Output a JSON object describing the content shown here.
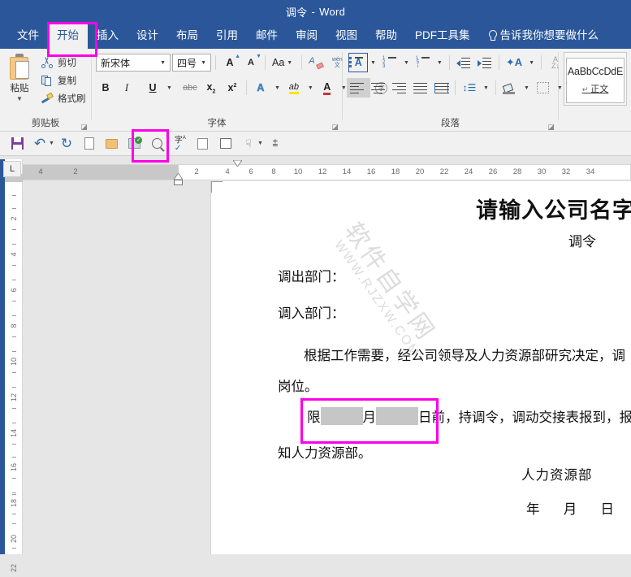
{
  "titlebar": {
    "document_name": "调令",
    "separator": "-",
    "app_name": "Word"
  },
  "tabs": [
    {
      "id": "file",
      "label": "文件"
    },
    {
      "id": "home",
      "label": "开始",
      "active": true,
      "highlighted": true
    },
    {
      "id": "insert",
      "label": "插入"
    },
    {
      "id": "design",
      "label": "设计"
    },
    {
      "id": "layout",
      "label": "布局"
    },
    {
      "id": "references",
      "label": "引用"
    },
    {
      "id": "mailings",
      "label": "邮件"
    },
    {
      "id": "review",
      "label": "审阅"
    },
    {
      "id": "view",
      "label": "视图"
    },
    {
      "id": "help",
      "label": "帮助"
    },
    {
      "id": "pdftools",
      "label": "PDF工具集"
    },
    {
      "id": "tellme",
      "label": "告诉我你想要做什么"
    }
  ],
  "ribbon": {
    "clipboard": {
      "group_label": "剪贴板",
      "paste_label": "粘贴",
      "cut_label": "剪切",
      "copy_label": "复制",
      "format_painter_label": "格式刷"
    },
    "font": {
      "group_label": "字体",
      "font_name": "新宋体",
      "font_size": "四号",
      "bold": "B",
      "italic": "I",
      "underline": "U",
      "strikethrough": "abc",
      "subscript": "x",
      "superscript": "x",
      "text_effects": "A",
      "highlight": "ab",
      "font_color": "A",
      "char_shading": "A",
      "char_border": "字",
      "grow_font": "A",
      "shrink_font": "A",
      "change_case": "Aa",
      "clear_formatting": "A",
      "phonetic_guide": "wén文",
      "underline_highlighted": true
    },
    "paragraph": {
      "group_label": "段落",
      "bullets": "bullets-icon",
      "numbering": "numbering-icon",
      "multilevel": "multilevel-list-icon",
      "decrease_indent": "decrease-indent-icon",
      "increase_indent": "increase-indent-icon",
      "asian_layout": "asian-layout-icon",
      "sort": "AZ",
      "show_marks": "pilcrow-icon",
      "align_left": "align-left-icon",
      "align_center": "align-center-icon",
      "align_right": "align-right-icon",
      "justify": "justify-icon",
      "distribute": "distribute-icon",
      "line_spacing": "line-spacing-icon",
      "shading": "shading-icon",
      "borders": "borders-icon"
    },
    "styles": {
      "sample_text": "AaBbCcDdE",
      "style_name": "正文",
      "pilcrow": "↵"
    }
  },
  "quick_access": [
    {
      "id": "save",
      "icon": "save-icon"
    },
    {
      "id": "undo",
      "icon": "undo-icon"
    },
    {
      "id": "redo",
      "icon": "redo-icon"
    },
    {
      "id": "new",
      "icon": "new-document-icon"
    },
    {
      "id": "open",
      "icon": "open-folder-icon"
    },
    {
      "id": "quickprint",
      "icon": "quick-print-icon"
    },
    {
      "id": "preview",
      "icon": "print-preview-icon"
    },
    {
      "id": "spelling",
      "icon": "spelling-check-icon"
    },
    {
      "id": "attach",
      "icon": "attachment-icon"
    },
    {
      "id": "edit",
      "icon": "edit-table-icon"
    },
    {
      "id": "touch",
      "icon": "touch-mode-icon"
    },
    {
      "id": "more",
      "icon": "more-options-icon"
    }
  ],
  "rulers": {
    "tab_stop_marker": "L",
    "horizontal_left_margin": [
      "4",
      "2"
    ],
    "horizontal_ticks": [
      "2",
      "4",
      "6",
      "8",
      "10",
      "12",
      "14",
      "16",
      "18",
      "20",
      "22",
      "24",
      "26",
      "28",
      "30",
      "32",
      "34"
    ],
    "vertical_ticks": [
      "2",
      "4",
      "6",
      "8",
      "10",
      "12",
      "14",
      "16",
      "18",
      "20",
      "22"
    ]
  },
  "document": {
    "watermark_line1": "软件自学网",
    "watermark_line2": "WWW.RJZXW.COM",
    "title": "请输入公司名字",
    "subtitle": "调令",
    "line_from_dept": "调出部门：",
    "line_to_dept": "调入部门：",
    "body_paragraph": "根据工作需要，经公司领导及人力资源部研究决定，调",
    "body_paragraph_cont": "岗位。",
    "limit_prefix": "限",
    "limit_month": "月",
    "limit_day": "日前，",
    "limit_rest": "持调令，调动交接表报到，报",
    "limit_next_line": "知人力资源部。",
    "signature_dept": "人力资源部",
    "signature_date": "年 月 日"
  },
  "annotations": {
    "highlight_color": "#ff00e6",
    "highlighted_items": [
      "开始",
      "U",
      "限  月  日前，"
    ]
  },
  "colors": {
    "title_bar": "#2b579a",
    "ribbon_bg": "#f1f1f1",
    "workspace_bg": "#e6e6e6",
    "page_bg": "#ffffff",
    "accent": "#2b6cb0",
    "annotation": "#ff00e6"
  }
}
